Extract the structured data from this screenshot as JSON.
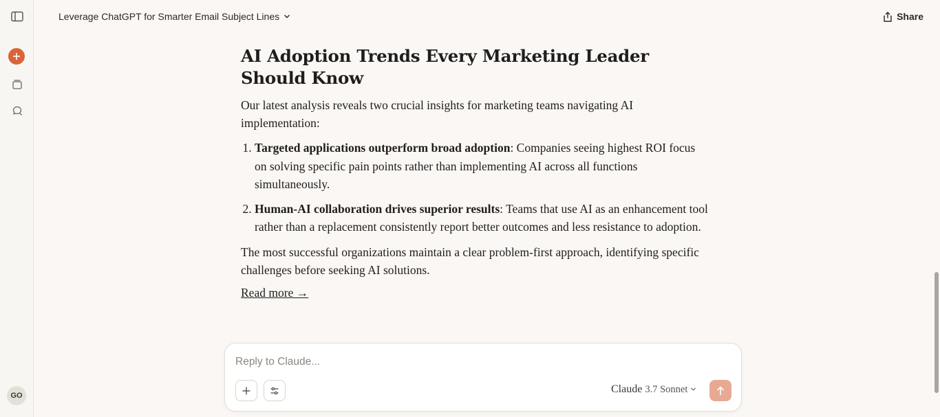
{
  "header": {
    "title": "Leverage ChatGPT for Smarter Email Subject Lines",
    "share_label": "Share"
  },
  "sidebar": {
    "icons": [
      "sidebar-toggle-icon",
      "new-chat-icon",
      "chats-icon",
      "search-icon"
    ],
    "avatar_initials": "GO"
  },
  "article": {
    "heading": "AI Adoption Trends Every Marketing Leader Should Know",
    "intro": "Our latest analysis reveals two crucial insights for marketing teams navigating AI implementation:",
    "items": [
      {
        "bold": "Targeted applications outperform broad adoption",
        "text": ": Companies seeing highest ROI focus on solving specific pain points rather than implementing AI across all functions simultaneously."
      },
      {
        "bold": "Human-AI collaboration drives superior results",
        "text": ": Teams that use AI as an enhancement tool rather than a replacement consistently report better outcomes and less resistance to adoption."
      }
    ],
    "closing": "The most successful organizations maintain a clear problem-first approach, identifying specific challenges before seeking AI solutions.",
    "read_more": "Read more →"
  },
  "composer": {
    "placeholder": "Reply to Claude...",
    "model_name": "Claude",
    "model_version": "3.7 Sonnet"
  },
  "colors": {
    "accent": "#d9643a",
    "send_button": "#e8a993",
    "background": "#faf7f4"
  }
}
